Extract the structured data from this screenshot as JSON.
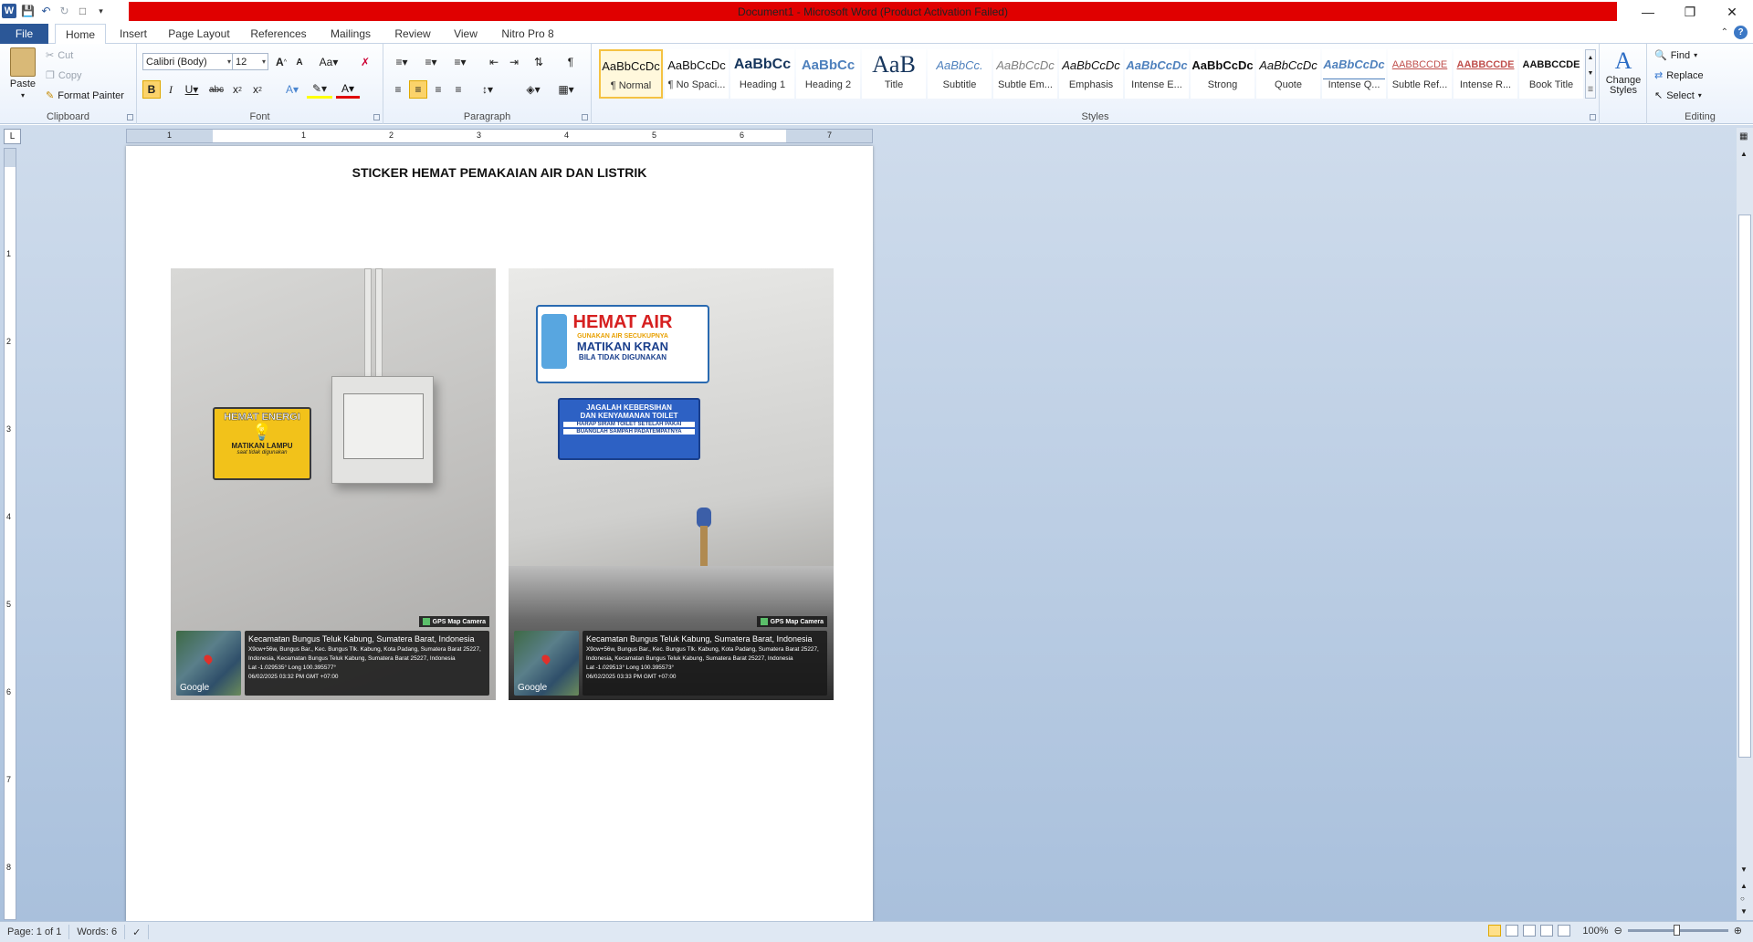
{
  "window": {
    "title": "Document1  -  Microsoft Word (Product Activation Failed)"
  },
  "tabs": [
    "File",
    "Home",
    "Insert",
    "Page Layout",
    "References",
    "Mailings",
    "Review",
    "View",
    "Nitro Pro 8"
  ],
  "clipboard": {
    "paste": "Paste",
    "cut": "Cut",
    "copy": "Copy",
    "format_painter": "Format Painter",
    "label": "Clipboard"
  },
  "font": {
    "name": "Calibri (Body)",
    "size": "12",
    "label": "Font"
  },
  "paragraph": {
    "label": "Paragraph"
  },
  "styles": {
    "label": "Styles",
    "items": [
      {
        "preview": "AaBbCcDc",
        "name": "¶ Normal"
      },
      {
        "preview": "AaBbCcDc",
        "name": "¶ No Spaci..."
      },
      {
        "preview": "AaBbCc",
        "name": "Heading 1"
      },
      {
        "preview": "AaBbCc",
        "name": "Heading 2"
      },
      {
        "preview": "AaB",
        "name": "Title"
      },
      {
        "preview": "AaBbCc.",
        "name": "Subtitle"
      },
      {
        "preview": "AaBbCcDc",
        "name": "Subtle Em..."
      },
      {
        "preview": "AaBbCcDc",
        "name": "Emphasis"
      },
      {
        "preview": "AaBbCcDc",
        "name": "Intense E..."
      },
      {
        "preview": "AaBbCcDc",
        "name": "Strong"
      },
      {
        "preview": "AaBbCcDc",
        "name": "Quote"
      },
      {
        "preview": "AaBbCcDc",
        "name": "Intense Q..."
      },
      {
        "preview": "AABBCCDE",
        "name": "Subtle Ref..."
      },
      {
        "preview": "AABBCCDE",
        "name": "Intense R..."
      },
      {
        "preview": "AABBCCDE",
        "name": "Book Title"
      }
    ],
    "change_styles": "Change Styles"
  },
  "editing": {
    "find": "Find",
    "replace": "Replace",
    "select": "Select",
    "label": "Editing"
  },
  "document": {
    "title": "STICKER HEMAT PEMAKAIAN AIR DAN LISTRIK",
    "photos": [
      {
        "sticker_title": "HEMAT ENERGI",
        "sticker_sub": "MATIKAN LAMPU",
        "sticker_sub2": "saat tidak digunakan",
        "gps_badge": "GPS Map Camera",
        "place": "Kecamatan Bungus Teluk Kabung, Sumatera Barat, Indonesia",
        "address": "X9cw+56w, Bungus Bar., Kec. Bungus Tlk. Kabung, Kota Padang, Sumatera Barat 25227, Indonesia, Kecamatan Bungus Teluk Kabung, Sumatera Barat 25227, Indonesia",
        "latlong": "Lat -1.029535° Long 100.395577°",
        "datetime": "06/02/2025 03:32 PM GMT +07:00",
        "map_label": "Google"
      },
      {
        "sticker_title": "HEMAT AIR",
        "sticker_line2": "GUNAKAN AIR SECUKUPNYA",
        "sticker_line3": "MATIKAN KRAN",
        "sticker_line4": "BILA TIDAK DIGUNAKAN",
        "sticker2_line1": "JAGALAH KEBERSIHAN",
        "sticker2_line2": "DAN KENYAMANAN TOILET",
        "sticker2_line3": "HARAP SIRAM TOILET SETELAH PAKAI",
        "sticker2_line4": "BUANGLAH SAMPAH PADATEMPATNYA",
        "gps_badge": "GPS Map Camera",
        "place": "Kecamatan Bungus Teluk Kabung, Sumatera Barat, Indonesia",
        "address": "X9cw+56w, Bungus Bar., Kec. Bungus Tlk. Kabung, Kota Padang, Sumatera Barat 25227, Indonesia, Kecamatan Bungus Teluk Kabung, Sumatera Barat 25227, Indonesia",
        "latlong": "Lat -1.029513° Long 100.395573°",
        "datetime": "06/02/2025 03:33 PM GMT +07:00",
        "map_label": "Google"
      }
    ]
  },
  "status": {
    "page": "Page: 1 of 1",
    "words": "Words: 6",
    "zoom": "100%"
  },
  "ruler": {
    "h_numbers": [
      "1",
      "1",
      "2",
      "3",
      "4",
      "5",
      "6",
      "7"
    ],
    "v_numbers": [
      "1",
      "2",
      "3",
      "4",
      "5",
      "6",
      "7",
      "8"
    ]
  }
}
